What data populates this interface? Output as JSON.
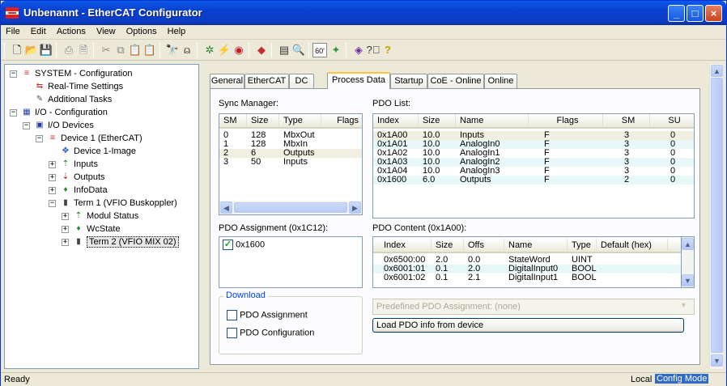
{
  "window": {
    "title": "Unbenannt - EtherCAT Configurator",
    "controls": [
      "_",
      "□",
      "×"
    ]
  },
  "menu": [
    "File",
    "Edit",
    "Actions",
    "View",
    "Options",
    "Help"
  ],
  "toolbar": {
    "icons": [
      "new-icon",
      "open-icon",
      "save-icon",
      "print-icon",
      "print-preview-icon",
      "cut-icon",
      "copy-icon",
      "paste-icon",
      "paste-special-icon",
      "find-icon",
      "find-next-icon",
      "scan-devices-icon",
      "reload-icon",
      "toggle-free-run-icon",
      "show-online-icon",
      "show-process-image-icon",
      "zoom-icon",
      "watch-icon",
      "device-wizard-icon",
      "mapping-icon",
      "help-icon",
      "about-icon"
    ]
  },
  "tree": [
    {
      "label": "SYSTEM - Configuration",
      "level": 0,
      "pm": "-",
      "icon": "system-icon"
    },
    {
      "label": "Real-Time Settings",
      "level": 1,
      "pm": "",
      "icon": "realtime-icon"
    },
    {
      "label": "Additional Tasks",
      "level": 1,
      "pm": "",
      "icon": "tasks-icon"
    },
    {
      "label": "I/O - Configuration",
      "level": 0,
      "pm": "-",
      "icon": "io-config-icon"
    },
    {
      "label": "I/O Devices",
      "level": 1,
      "pm": "-",
      "icon": "io-devices-icon"
    },
    {
      "label": "Device 1 (EtherCAT)",
      "level": 2,
      "pm": "-",
      "icon": "ethercat-device-icon"
    },
    {
      "label": "Device 1-Image",
      "level": 3,
      "pm": "",
      "icon": "image-icon"
    },
    {
      "label": "Inputs",
      "level": 3,
      "pm": "+",
      "icon": "inputs-icon"
    },
    {
      "label": "Outputs",
      "level": 3,
      "pm": "+",
      "icon": "outputs-icon"
    },
    {
      "label": "InfoData",
      "level": 3,
      "pm": "+",
      "icon": "infodata-icon"
    },
    {
      "label": "Term 1 (VFIO Buskoppler)",
      "level": 3,
      "pm": "-",
      "icon": "terminal-icon"
    },
    {
      "label": "Modul Status",
      "level": 4,
      "pm": "+",
      "icon": "inputs-icon"
    },
    {
      "label": "WcState",
      "level": 4,
      "pm": "+",
      "icon": "infodata-icon"
    },
    {
      "label": "Term 2 (VFIO MIX 02)",
      "level": 4,
      "pm": "+",
      "icon": "terminal-icon",
      "selected": true
    }
  ],
  "tabs": [
    "General",
    "EtherCAT",
    "DC",
    "Process Data",
    "Startup",
    "CoE - Online",
    "Online"
  ],
  "active_tab": "Process Data",
  "sync_manager": {
    "label": "Sync Manager:",
    "headers": [
      "SM",
      "Size",
      "Type",
      "Flags"
    ],
    "rows": [
      [
        "0",
        "128",
        "MbxOut",
        ""
      ],
      [
        "1",
        "128",
        "MbxIn",
        ""
      ],
      [
        "2",
        "6",
        "Outputs",
        ""
      ],
      [
        "3",
        "50",
        "Inputs",
        ""
      ]
    ],
    "selected_row": 2
  },
  "pdo_list": {
    "label": "PDO List:",
    "headers": [
      "Index",
      "Size",
      "Name",
      "Flags",
      "SM",
      "SU"
    ],
    "rows": [
      [
        "0x1A00",
        "10.0",
        "Inputs",
        "F",
        "3",
        "0"
      ],
      [
        "0x1A01",
        "10.0",
        "AnalogIn0",
        "F",
        "3",
        "0"
      ],
      [
        "0x1A02",
        "10.0",
        "AnalogIn1",
        "F",
        "3",
        "0"
      ],
      [
        "0x1A03",
        "10.0",
        "AnalogIn2",
        "F",
        "3",
        "0"
      ],
      [
        "0x1A04",
        "10.0",
        "AnalogIn3",
        "F",
        "3",
        "0"
      ],
      [
        "0x1600",
        "6.0",
        "Outputs",
        "F",
        "2",
        "0"
      ]
    ],
    "selected_row": 0
  },
  "pdo_assignment": {
    "label": "PDO Assignment (0x1C12):",
    "items": [
      {
        "label": "0x1600",
        "checked": true
      }
    ]
  },
  "pdo_content": {
    "label": "PDO Content (0x1A00):",
    "headers": [
      "Index",
      "Size",
      "Offs",
      "Name",
      "Type",
      "Default (hex)"
    ],
    "rows": [
      [
        "0x6500:00",
        "2.0",
        "0.0",
        "StateWord",
        "UINT",
        ""
      ],
      [
        "0x6001:01",
        "0.1",
        "2.0",
        "DigitalInput0",
        "BOOL",
        ""
      ],
      [
        "0x6001:02",
        "0.1",
        "2.1",
        "DigitalInput1",
        "BOOL",
        ""
      ]
    ]
  },
  "download": {
    "label": "Download",
    "pdo_assignment": "PDO Assignment",
    "pdo_configuration": "PDO Configuration"
  },
  "predefined": "Predefined PDO Assignment: (none)",
  "load_button": "Load PDO info from device",
  "status": {
    "text": "Ready",
    "mode": "Local",
    "config": "Config Mode"
  },
  "colors": {
    "title": "#0a46d8",
    "selection_row": "#f1efe2",
    "alt_row": "#e8f8f8",
    "config_mode": "#316ac5"
  }
}
